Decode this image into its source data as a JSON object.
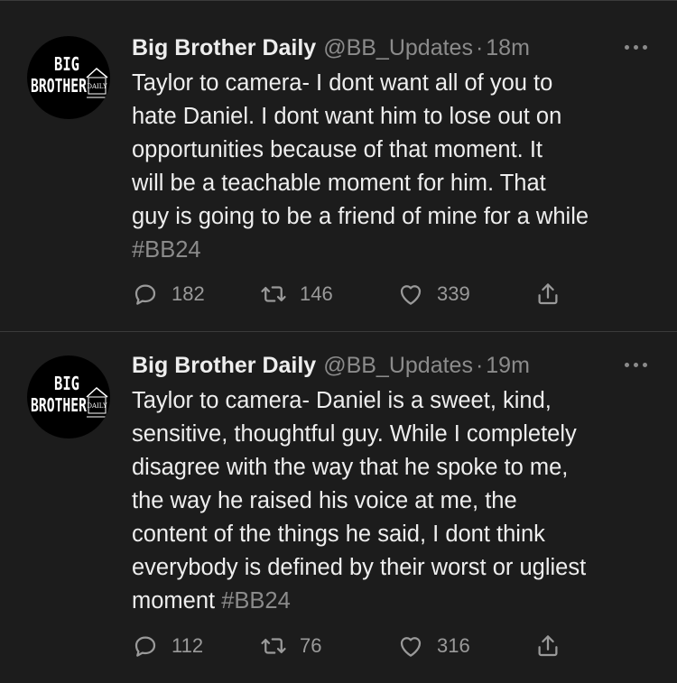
{
  "tweets": [
    {
      "author": {
        "name": "Big Brother Daily",
        "handle": "@BB_Updates",
        "avatar_text_top": "BIG",
        "avatar_text_bottom": "BROTHER",
        "avatar_text_side": "DAILY"
      },
      "separator": "·",
      "time": "18m",
      "text": "Taylor to camera- I dont want all of you to\nhate Daniel. I dont want him to lose out on\nopportunities because of that moment. It\nwill be a teachable moment for him. That\nguy is going to be a friend of mine for a while\n",
      "hashtag": "#BB24",
      "replies": "182",
      "retweets": "146",
      "likes": "339"
    },
    {
      "author": {
        "name": "Big Brother Daily",
        "handle": "@BB_Updates",
        "avatar_text_top": "BIG",
        "avatar_text_bottom": "BROTHER",
        "avatar_text_side": "DAILY"
      },
      "separator": "·",
      "time": "19m",
      "text": "Taylor to camera- Daniel is a sweet, kind,\nsensitive, thoughtful guy. While I completely\ndisagree with the way that he spoke to me,\nthe way he raised his voice at me, the\ncontent of the things he said, I dont think\neverybody is defined by their worst or ugliest\nmoment ",
      "hashtag": "#BB24",
      "replies": "112",
      "retweets": "76",
      "likes": "316"
    }
  ],
  "icons": {
    "reply": "reply-icon",
    "retweet": "retweet-icon",
    "like": "heart-icon",
    "share": "share-icon",
    "more": "more-icon"
  },
  "colors": {
    "background": "#1c1c1c",
    "text": "#eeeeee",
    "muted": "#8b8b8b",
    "divider": "#3a3a3a"
  }
}
